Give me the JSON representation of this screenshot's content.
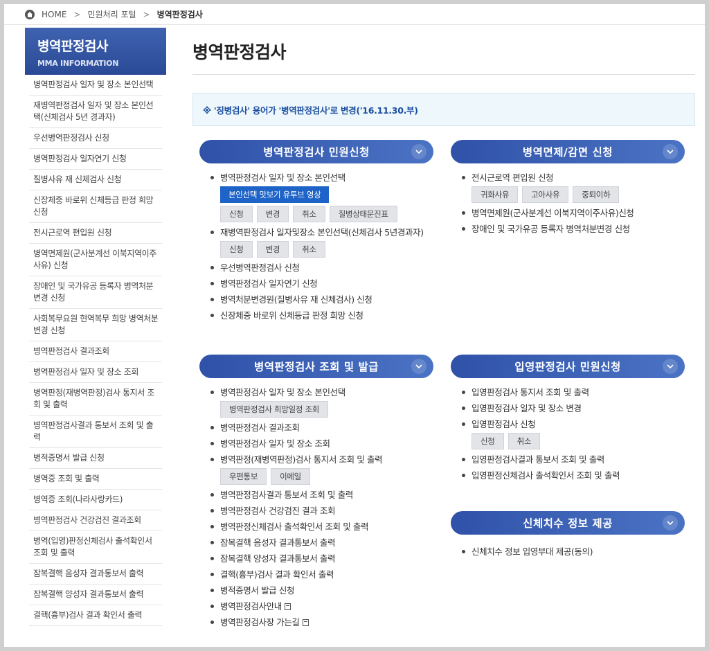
{
  "breadcrumb": {
    "home": "HOME",
    "sep": ">",
    "level1": "민원처리 포털",
    "current": "병역판정검사"
  },
  "sidebar": {
    "title": "병역판정검사",
    "subtitle": "MMA INFORMATION",
    "items": [
      "병역판정검사 일자 및 장소 본인선택",
      "재병역판정검사 일자 및 장소 본인선택(신체검사 5년 경과자)",
      "우선병역판정검사 신청",
      "병역판정검사 일자연기 신청",
      "질병사유 재 신체검사 신청",
      "신장체중 바로위 신체등급 판정 희망 신청",
      "전시근로역 편입원 신청",
      "병역면제원(군사분계선 이북지역이주사유) 신청",
      "장애인 및 국가유공 등록자 병역처분변경 신청",
      "사회복무요원 현역복무 희망 병역처분변경 신청",
      "병역판정검사 결과조회",
      "병역판정검사 일자 및 장소 조회",
      "병역판정(재병역판정)검사 통지서 조회 및 출력",
      "병역판정검사결과 통보서 조회 및 출력",
      "병적증명서 발급 신청",
      "병역증 조회 및 출력",
      "병역증 조회(나라사랑카드)",
      "병역판정검사 건강검진 결과조회",
      "병역(입영)판정신체검사 출석확인서 조회 및 출력",
      "잠복결핵 음성자 결과통보서 출력",
      "잠복결핵 양성자 결과통보서 출력",
      "결핵(흉부)검사 결과 확인서 출력"
    ]
  },
  "main": {
    "title": "병역판정검사",
    "notice": "※ '징병검사' 용어가 '병역판정검사'로 변경('16.11.30.부)"
  },
  "sections": {
    "s1": {
      "title": "병역판정검사 민원신청",
      "item1": "병역판정검사 일자 및 장소 본인선택",
      "video_btn": "본인선택 맛보기 유투브 영상",
      "btns1": [
        "신청",
        "변경",
        "취소",
        "질병상태문진표"
      ],
      "item2": "재병역판정검사 일자및장소 본인선택(신체검사 5년경과자)",
      "btns2": [
        "신청",
        "변경",
        "취소"
      ],
      "item3": "우선병역판정검사 신청",
      "item4": "병역판정검사 일자연기 신청",
      "item5": "병역처분변경원(질병사유 재 신체검사) 신청",
      "item6": "신장체중 바로위 신체등급 판정 희망 신청"
    },
    "s2": {
      "title": "병역면제/감면 신청",
      "item1": "전시근로역 편입원 신청",
      "btns1": [
        "귀화사유",
        "고아사유",
        "중퇴이하"
      ],
      "item2": "병역면제원(군사분계선 이북지역이주사유)신청",
      "item3": "장애인 및 국가유공 등록자 병역처분변경 신청"
    },
    "s3": {
      "title": "병역판정검사 조회 및 발급",
      "item1": "병역판정검사 일자 및 장소 본인선택",
      "btn_schedule": "병역판정검사 희망일정 조회",
      "item2": "병역판정검사 결과조회",
      "item3": "병역판정검사 일자 및 장소 조회",
      "item4": "병역판정(재병역판정)검사 통지서 조회 및 출력",
      "btns4": [
        "우편통보",
        "이메일"
      ],
      "item5": "병역판정검사결과 통보서 조회 및 출력",
      "item6": "병역판정검사 건강검진 결과 조회",
      "item7": "병역판정신체검사 출석확인서 조회 및 출력",
      "item8": "잠복결핵 음성자 결과통보서 출력",
      "item9": "잠복결핵 양성자 결과통보서 출력",
      "item10": "결핵(흉부)검사 결과 확인서 출력",
      "item11": "병적증명서 발급 신청",
      "item12": "병역판정검사안내",
      "item13": "병역판정검사장 가는길"
    },
    "s4": {
      "title": "입영판정검사 민원신청",
      "item1": "입영판정검사 통지서 조회 및 출력",
      "item2": "입영판정검사 일자 및 장소 변경",
      "item3": "입영판정검사 신청",
      "btns3": [
        "신청",
        "취소"
      ],
      "item4": "입영판정검사결과 통보서 조회 및 출력",
      "item5": "입영판정신체검사 출석확인서 조회 및 출력"
    },
    "s5": {
      "title": "신체치수 정보 제공",
      "item1": "신체치수 정보 입영부대 제공(동의)"
    }
  },
  "icons": {
    "chevron": "chevron-down-icon",
    "home": "home-icon",
    "doc": "document-icon"
  },
  "colors": {
    "accent": "#2f52a8",
    "primary_button": "#1d63c8",
    "notice_text": "#1b4ea0"
  }
}
